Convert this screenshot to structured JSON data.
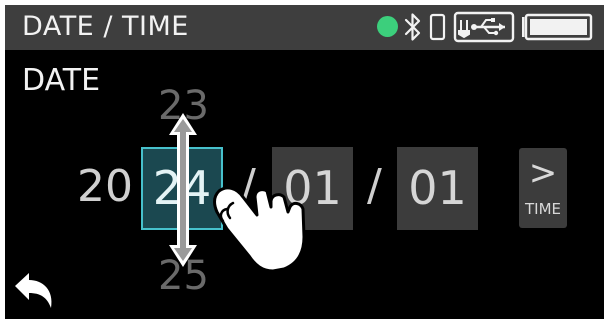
{
  "status_bar": {
    "title": "DATE / TIME",
    "icons": [
      "status-dot-icon",
      "bluetooth-icon",
      "smartphone-icon",
      "usb-icon",
      "battery-icon"
    ],
    "status_dot_color": "#3ccf7c"
  },
  "section_label": "DATE",
  "date": {
    "year_prefix": "20",
    "year_value": "24",
    "year_previous": "23",
    "year_next": "25",
    "month": "01",
    "day": "01",
    "separator": "/"
  },
  "next_button": {
    "chevron": ">",
    "label": "TIME"
  },
  "back_button": {
    "icon": "back-arrow-icon"
  },
  "gesture_hint": {
    "icons": [
      "up-down-arrow-icon",
      "touch-hand-icon"
    ]
  },
  "colors": {
    "background": "#000000",
    "status_bar": "#3e3e3e",
    "field": "#3c3c3c",
    "active_field": "#1b4850",
    "active_border": "#47c1cc"
  }
}
